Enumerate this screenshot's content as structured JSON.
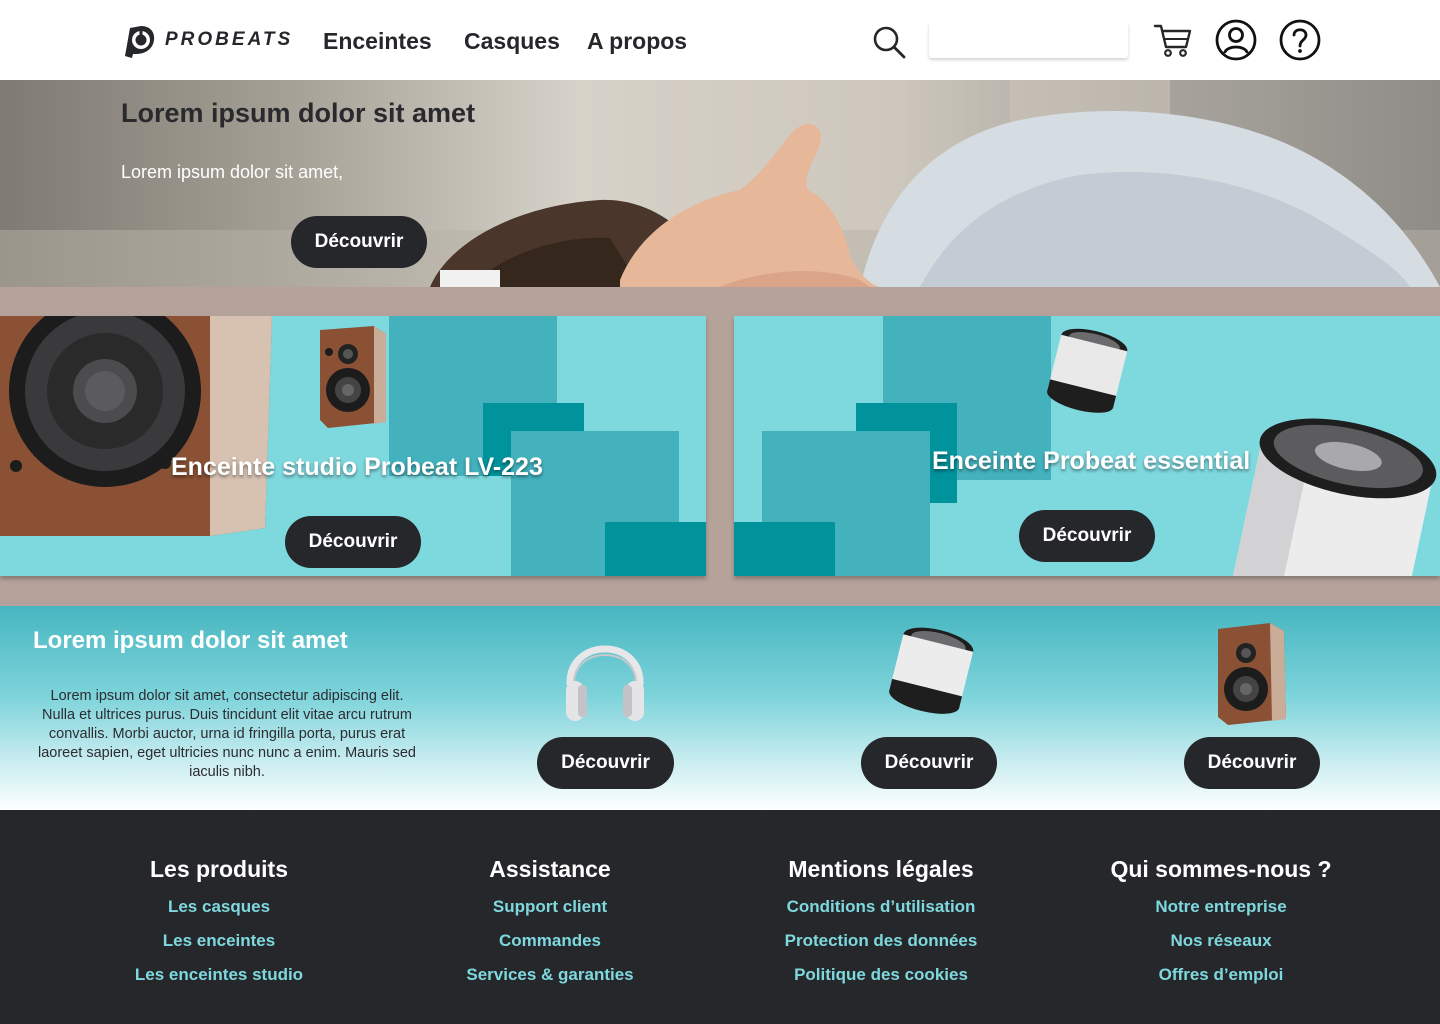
{
  "header": {
    "logo_text": "PROBEATS",
    "nav": [
      "Enceintes",
      "Casques",
      "A propos"
    ],
    "search_placeholder": "",
    "icons": [
      "search-icon",
      "cart-icon",
      "account-icon",
      "help-icon"
    ]
  },
  "hero": {
    "title": "Lorem ipsum dolor sit amet",
    "subtitle": "Lorem ipsum dolor sit amet,",
    "button": "Découvrir"
  },
  "promos": [
    {
      "title": "Enceinte studio Probeat LV-223",
      "button": "Découvrir"
    },
    {
      "title": "Enceinte Probeat essential",
      "button": "Découvrir"
    }
  ],
  "products": {
    "title": "Lorem ipsum dolor sit amet",
    "text": "Lorem ipsum dolor sit amet, consectetur adipiscing elit. Nulla et ultrices purus. Duis tincidunt elit vitae arcu rutrum convallis. Morbi auctor, urna id fringilla porta, purus erat laoreet sapien, eget ultricies nunc nunc a enim. Mauris sed iaculis nibh.",
    "items": [
      {
        "icon": "headphones-icon",
        "button": "Découvrir"
      },
      {
        "icon": "portable-speaker-icon",
        "button": "Découvrir"
      },
      {
        "icon": "studio-speaker-icon",
        "button": "Découvrir"
      }
    ]
  },
  "footer": {
    "columns": [
      {
        "title": "Les produits",
        "links": [
          "Les casques",
          "Les enceintes",
          "Les enceintes studio"
        ]
      },
      {
        "title": "Assistance",
        "links": [
          "Support client",
          "Commandes",
          "Services & garanties"
        ]
      },
      {
        "title": "Mentions légales",
        "links": [
          "Conditions d’utilisation",
          "Protection des données",
          "Politique des cookies"
        ]
      },
      {
        "title": "Qui sommes-nous ?",
        "links": [
          "Notre entreprise",
          "Nos réseaux",
          "Offres d’emploi"
        ]
      }
    ]
  },
  "colors": {
    "dark": "#26272b",
    "teal_light": "#7ed9df",
    "teal_mid": "#43b2bd",
    "teal_dark": "#00939b",
    "band": "#b5a29b"
  }
}
